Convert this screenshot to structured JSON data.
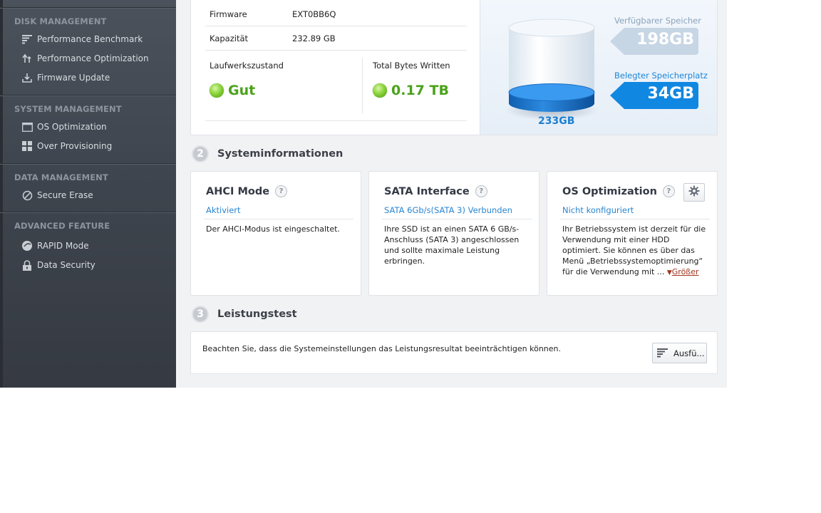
{
  "sidebar": {
    "sections": [
      {
        "title": "DISK MANAGEMENT",
        "items": [
          "Performance Benchmark",
          "Performance Optimization",
          "Firmware Update"
        ]
      },
      {
        "title": "SYSTEM MANAGEMENT",
        "items": [
          "OS Optimization",
          "Over Provisioning"
        ]
      },
      {
        "title": "DATA MANAGEMENT",
        "items": [
          "Secure Erase"
        ]
      },
      {
        "title": "ADVANCED FEATURE",
        "items": [
          "RAPID Mode",
          "Data Security"
        ]
      }
    ]
  },
  "drive_info": {
    "firmware_label": "Firmware",
    "firmware_value": "EXT0BB6Q",
    "capacity_label": "Kapazität",
    "capacity_value": "232.89 GB",
    "health_label": "Laufwerkszustand",
    "health_value": "Gut",
    "tbw_label": "Total Bytes Written",
    "tbw_value": "0.17 TB"
  },
  "storage": {
    "free_label": "Verfügbarer Speicher",
    "free_value": "198GB",
    "used_label": "Belegter Speicherplatz",
    "used_value": "34GB",
    "total_value": "233GB",
    "used_fraction": 0.146
  },
  "sysinfo": {
    "number": "2",
    "title": "Systeminformationen",
    "cards": [
      {
        "title": "AHCI Mode",
        "status": "Aktiviert",
        "desc": "Der AHCI-Modus ist eingeschaltet."
      },
      {
        "title": "SATA Interface",
        "status": "SATA 6Gb/s(SATA 3) Verbunden",
        "desc": "Ihre SSD ist an einen SATA 6 GB/s-Anschluss (SATA 3) angeschlossen und sollte maximale Leistung erbringen."
      },
      {
        "title": "OS Optimization",
        "status": "Nicht konfiguriert",
        "desc": "Ihr Betriebssystem ist derzeit für die Verwendung mit einer HDD optimiert. Sie können es über das Menü „Betriebssystemoptimierung“ für die Verwendung mit ...",
        "more": "Größer"
      }
    ],
    "help_glyph": "?"
  },
  "perf": {
    "number": "3",
    "title": "Leistungstest",
    "note": "Beachten Sie, dass die Systemeinstellungen das Leistungsresultat beeinträchtigen können.",
    "run_label": "Ausfü..."
  }
}
